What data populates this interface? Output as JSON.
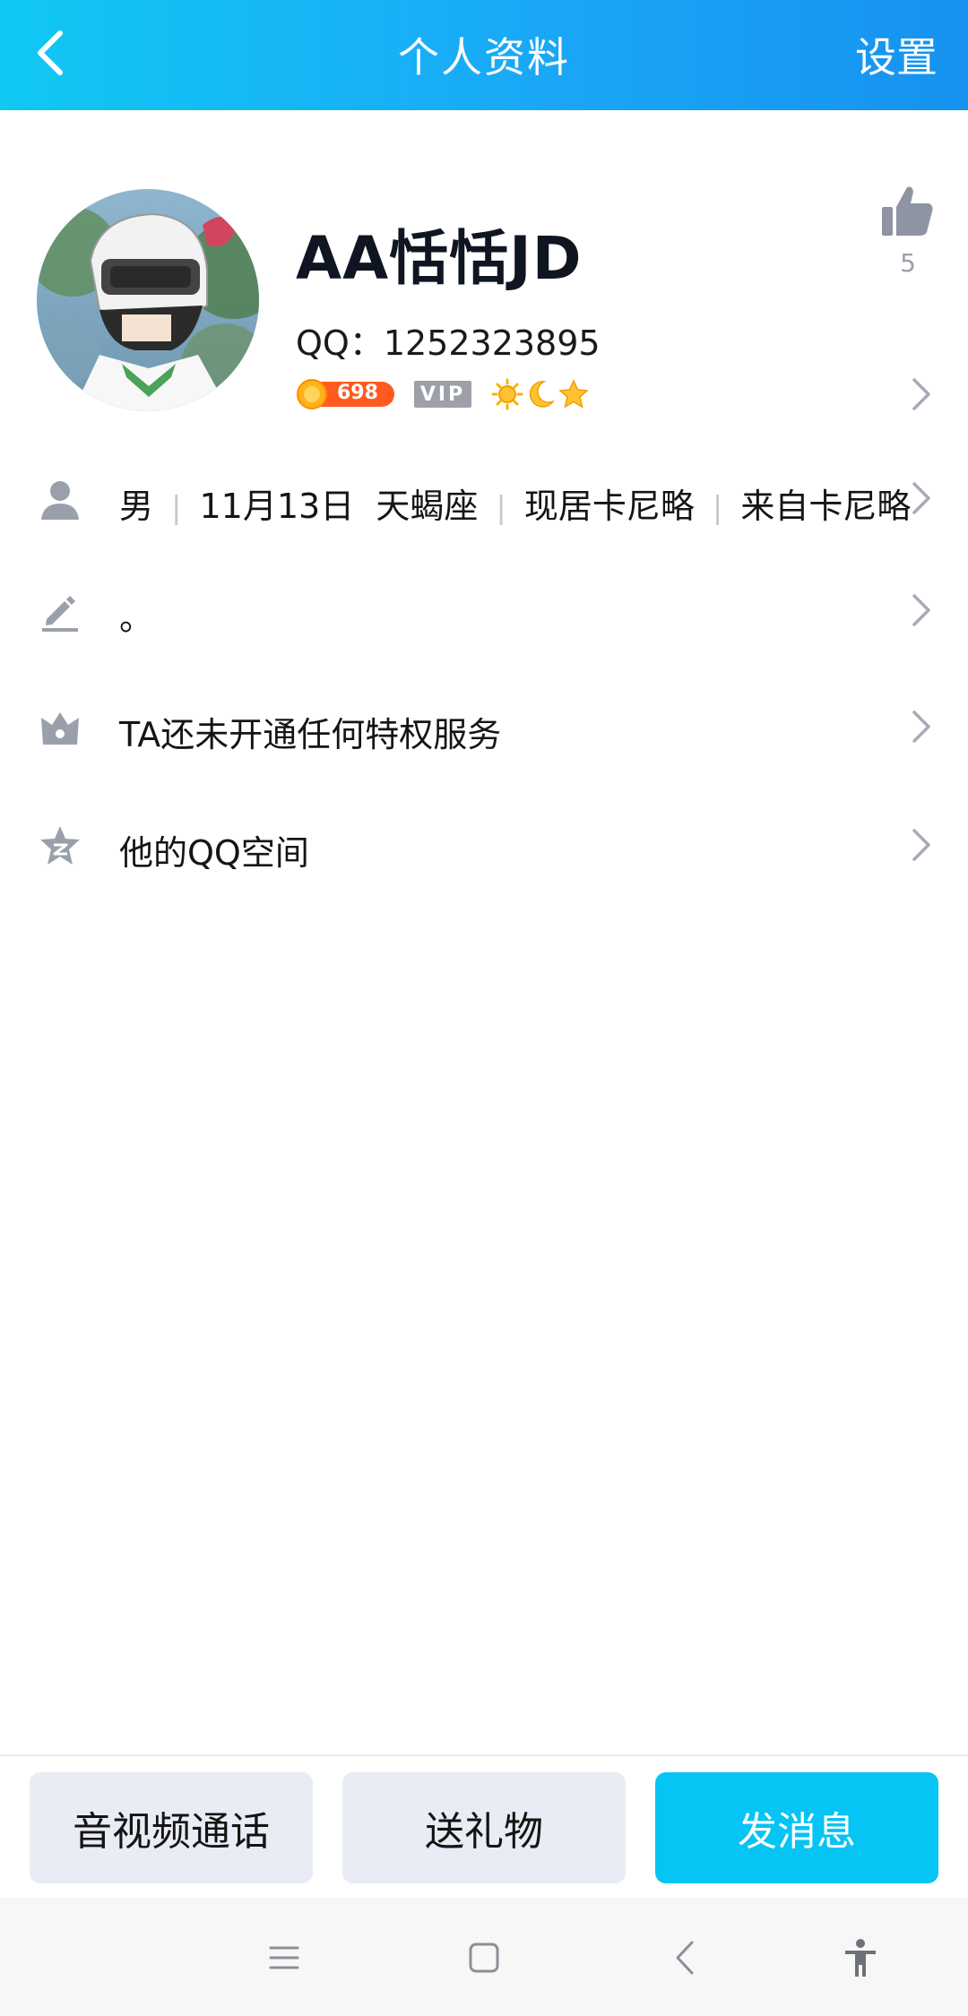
{
  "header": {
    "title": "个人资料",
    "settings_label": "设置"
  },
  "profile": {
    "nickname": "AA恬恬JD",
    "qq_label": "QQ：1252323895",
    "coin_badge_text": "698",
    "vip_badge_text": "VIP",
    "level_icons": [
      "sun-icon",
      "moon-icon",
      "star-icon"
    ],
    "like_count": "5"
  },
  "info_rows": {
    "basic": {
      "gender": "男",
      "birthday_and_sign": "11月13日  天蝎座",
      "residence": "现居卡尼略",
      "hometown": "来自卡尼略"
    },
    "signature": "。",
    "privilege": "TA还未开通任何特权服务",
    "qzone": "他的QQ空间"
  },
  "actions": {
    "call_label": "音视频通话",
    "gift_label": "送礼物",
    "message_label": "发消息"
  },
  "colors": {
    "header_gradient_start": "#10c8f4",
    "header_gradient_end": "#1692f0",
    "primary_button": "#06c4f3",
    "light_button": "#e9ecf4",
    "icon_gray": "#9aa0ab"
  }
}
